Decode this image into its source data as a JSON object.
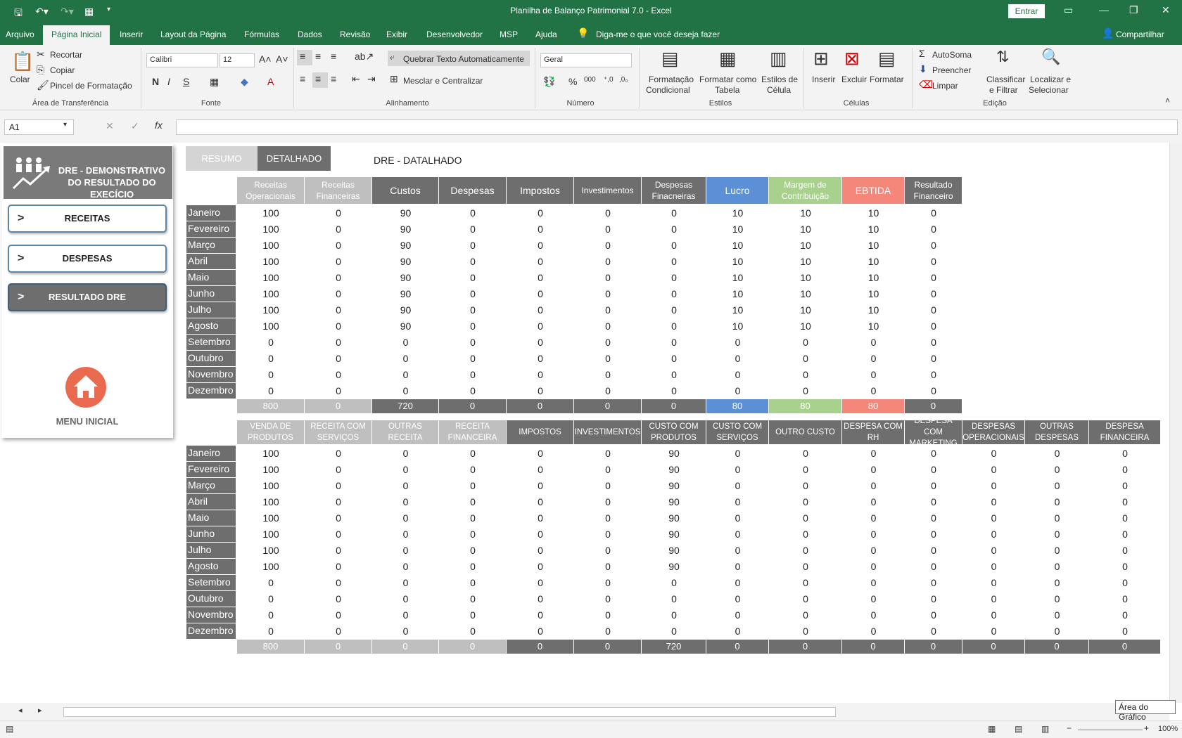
{
  "window": {
    "title": "Planilha de Balanço Patrimonial 7.0  -  Excel",
    "signin": "Entrar"
  },
  "menu": [
    "Arquivo",
    "Página Inicial",
    "Inserir",
    "Layout da Página",
    "Fórmulas",
    "Dados",
    "Revisão",
    "Exibir",
    "Desenvolvedor",
    "MSP",
    "Ajuda"
  ],
  "tellme": "Diga-me o que você deseja fazer",
  "share": "Compartilhar",
  "ribbon": {
    "colar": "Colar",
    "recortar": "Recortar",
    "copiar": "Copiar",
    "pincel": "Pincel de Formatação",
    "grp_clip": "Área de Transferência",
    "font_name": "Calibri",
    "font_size": "12",
    "grp_fonte": "Fonte",
    "wrap": "Quebrar Texto Automaticamente",
    "merge": "Mesclar e Centralizar",
    "grp_alinh": "Alinhamento",
    "numfmt": "Geral",
    "grp_num": "Número",
    "fc1": "Formatação",
    "fc2": "Condicional",
    "ft1": "Formatar como",
    "ft2": "Tabela",
    "ec1": "Estilos de",
    "ec2": "Célula",
    "grp_estilos": "Estilos",
    "inserir": "Inserir",
    "excluir": "Excluir",
    "formatar": "Formatar",
    "grp_celulas": "Células",
    "autosoma": "AutoSoma",
    "preencher": "Preencher",
    "limpar": "Limpar",
    "cf1": "Classificar",
    "cf2": "e Filtrar",
    "ls1": "Localizar e",
    "ls2": "Selecionar",
    "grp_edicao": "Edição"
  },
  "namebox": "A1",
  "panel": {
    "title": "DRE - DEMONSTRATIVO DO RESULTADO  DO EXECÍCIO",
    "btn_receitas": "RECEITAS",
    "btn_despesas": "DESPESAS",
    "btn_resultado": "RESULTADO DRE",
    "chevron": ">",
    "menu_inicial": "MENU INICIAL"
  },
  "tabs": {
    "resumo": "RESUMO",
    "detalhado": "DETALHADO"
  },
  "dre_title": "DRE - DATALHADO",
  "months": [
    "Janeiro",
    "Fevereiro",
    "Março",
    "Abril",
    "Maio",
    "Junho",
    "Julho",
    "Agosto",
    "Setembro",
    "Outubro",
    "Novembro",
    "Dezembro"
  ],
  "table1": {
    "headers": [
      "Receitas Operacionais",
      "Receitas Financeiras",
      "Custos",
      "Despesas",
      "Impostos",
      "Investimentos",
      "Despesas Finacneiras",
      "Lucro",
      "Margem de Contribuição",
      "EBTIDA",
      "Resultado Financeiro"
    ],
    "header_colors": [
      "#bfbfbf",
      "#bfbfbf",
      "#6e6e6e",
      "#6e6e6e",
      "#6e6e6e",
      "#6e6e6e",
      "#6e6e6e",
      "#5b8fd6",
      "#a9d18e",
      "#f4877a",
      "#6e6e6e"
    ],
    "rows": [
      [
        100,
        0,
        90,
        0,
        0,
        0,
        0,
        10,
        10,
        10,
        0
      ],
      [
        100,
        0,
        90,
        0,
        0,
        0,
        0,
        10,
        10,
        10,
        0
      ],
      [
        100,
        0,
        90,
        0,
        0,
        0,
        0,
        10,
        10,
        10,
        0
      ],
      [
        100,
        0,
        90,
        0,
        0,
        0,
        0,
        10,
        10,
        10,
        0
      ],
      [
        100,
        0,
        90,
        0,
        0,
        0,
        0,
        10,
        10,
        10,
        0
      ],
      [
        100,
        0,
        90,
        0,
        0,
        0,
        0,
        10,
        10,
        10,
        0
      ],
      [
        100,
        0,
        90,
        0,
        0,
        0,
        0,
        10,
        10,
        10,
        0
      ],
      [
        100,
        0,
        90,
        0,
        0,
        0,
        0,
        10,
        10,
        10,
        0
      ],
      [
        0,
        0,
        0,
        0,
        0,
        0,
        0,
        0,
        0,
        0,
        0
      ],
      [
        0,
        0,
        0,
        0,
        0,
        0,
        0,
        0,
        0,
        0,
        0
      ],
      [
        0,
        0,
        0,
        0,
        0,
        0,
        0,
        0,
        0,
        0,
        0
      ],
      [
        0,
        0,
        0,
        0,
        0,
        0,
        0,
        0,
        0,
        0,
        0
      ]
    ],
    "totals": [
      800,
      0,
      720,
      0,
      0,
      0,
      0,
      80,
      80,
      80,
      0
    ]
  },
  "table2": {
    "headers": [
      "VENDA DE PRODUTOS",
      "RECEITA COM SERVIÇOS",
      "OUTRAS RECEITA",
      "RECEITA FINANCEIRA",
      "IMPOSTOS",
      "INVESTIMENTOS",
      "CUSTO COM PRODUTOS",
      "CUSTO COM SERVIÇOS",
      "OUTRO CUSTO",
      "DESPESA COM RH",
      "DESPESA COM MARKETING",
      "DESPESAS OPERACIONAIS",
      "OUTRAS DESPESAS",
      "DESPESA FINANCEIRA"
    ],
    "rows": [
      [
        100,
        0,
        0,
        0,
        0,
        0,
        90,
        0,
        0,
        0,
        0,
        0,
        0,
        0
      ],
      [
        100,
        0,
        0,
        0,
        0,
        0,
        90,
        0,
        0,
        0,
        0,
        0,
        0,
        0
      ],
      [
        100,
        0,
        0,
        0,
        0,
        0,
        90,
        0,
        0,
        0,
        0,
        0,
        0,
        0
      ],
      [
        100,
        0,
        0,
        0,
        0,
        0,
        90,
        0,
        0,
        0,
        0,
        0,
        0,
        0
      ],
      [
        100,
        0,
        0,
        0,
        0,
        0,
        90,
        0,
        0,
        0,
        0,
        0,
        0,
        0
      ],
      [
        100,
        0,
        0,
        0,
        0,
        0,
        90,
        0,
        0,
        0,
        0,
        0,
        0,
        0
      ],
      [
        100,
        0,
        0,
        0,
        0,
        0,
        90,
        0,
        0,
        0,
        0,
        0,
        0,
        0
      ],
      [
        100,
        0,
        0,
        0,
        0,
        0,
        90,
        0,
        0,
        0,
        0,
        0,
        0,
        0
      ],
      [
        0,
        0,
        0,
        0,
        0,
        0,
        0,
        0,
        0,
        0,
        0,
        0,
        0,
        0
      ],
      [
        0,
        0,
        0,
        0,
        0,
        0,
        0,
        0,
        0,
        0,
        0,
        0,
        0,
        0
      ],
      [
        0,
        0,
        0,
        0,
        0,
        0,
        0,
        0,
        0,
        0,
        0,
        0,
        0,
        0
      ],
      [
        0,
        0,
        0,
        0,
        0,
        0,
        0,
        0,
        0,
        0,
        0,
        0,
        0,
        0
      ]
    ],
    "totals": [
      800,
      0,
      0,
      0,
      0,
      0,
      720,
      0,
      0,
      0,
      0,
      0,
      0,
      0
    ]
  },
  "tooltip": "Área do Gráfico",
  "zoom": "100%"
}
